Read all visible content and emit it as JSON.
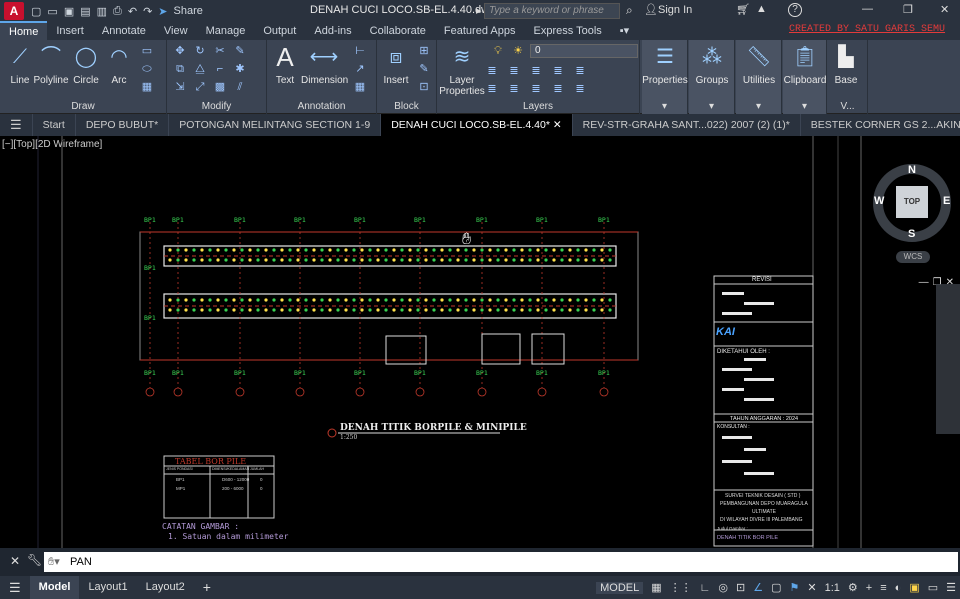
{
  "titlebar": {
    "logo": "A",
    "file_title": "DENAH CUCI LOCO.SB-EL.4.40.dwg",
    "share_label": "Share",
    "search_placeholder": "Type a keyword or phrase",
    "sign_in": "Sign In",
    "help": "?"
  },
  "ribbon_tabs": [
    "Home",
    "Insert",
    "Annotate",
    "View",
    "Manage",
    "Output",
    "Add-ins",
    "Collaborate",
    "Featured Apps",
    "Express Tools"
  ],
  "active_ribbon_tab": "Home",
  "credit_text": "CREATED BY SATU GARIS SEMU",
  "panels": {
    "draw": {
      "label": "Draw",
      "line": "Line",
      "polyline": "Polyline",
      "circle": "Circle",
      "arc": "Arc"
    },
    "modify": {
      "label": "Modify"
    },
    "annotation": {
      "label": "Annotation",
      "text": "Text",
      "dimension": "Dimension"
    },
    "block": {
      "label": "Block",
      "insert": "Insert"
    },
    "layers": {
      "label": "Layers",
      "layer_properties_1": "Layer",
      "layer_properties_2": "Properties",
      "current_layer": "0"
    },
    "properties": "Properties",
    "groups": "Groups",
    "utilities": "Utilities",
    "clipboard": "Clipboard",
    "base": "Base",
    "view": "V..."
  },
  "doc_tabs": [
    "Start",
    "DEPO BUBUT*",
    "POTONGAN MELINTANG SECTION 1-9",
    "DENAH CUCI LOCO.SB-EL.4.40*",
    "REV-STR-GRAHA SANT...022) 2007 (2) (1)*",
    "BESTEK CORNER GS 2...AKIN 2007 (2) (1)*"
  ],
  "active_doc_tab": 3,
  "viewport_label": "[−][Top][2D Wireframe]",
  "drawing": {
    "pile_label": "BP1",
    "title": "DENAH TITIK BORPILE & MINIPILE",
    "scale": "1:250",
    "table_title": "TABEL BOR PILE",
    "table_headers": [
      "JENIS PONDASI",
      "DIMENSI/KEDALAMAN",
      "JUMLAH"
    ],
    "table_rows": [
      [
        "BP1",
        "D600 - 12000",
        "0"
      ],
      [
        "MP1",
        "200 - 6000",
        "0"
      ]
    ],
    "notes_title": "CATATAN GAMBAR :",
    "note_1": "1.  Satuan dalam milimeter",
    "revisi": "REVISI",
    "diketahui": "DIKETAHUI OLEH :",
    "tahun": "TAHUN ANGGARAN : 2024",
    "konsultan": "KONSULTAN :",
    "project_1": "SURVEI TEKNIK DESAIN ( STD )",
    "project_2": "PEMBANGUNAN DEPO MUARAGULA",
    "project_3": "ULTIMATE",
    "project_4": "DI WILAYAH DIVRE III PALEMBANG",
    "judul_label": "Judul Gambar :",
    "judul": "DENAH TITIK BOR PILE",
    "kai_logo": "KAI"
  },
  "viewcube": {
    "n": "N",
    "s": "S",
    "e": "E",
    "w": "W",
    "face": "TOP",
    "wcs": "WCS"
  },
  "command": {
    "prompt": "PAN"
  },
  "status": {
    "model_tab": "Model",
    "layout1": "Layout1",
    "layout2": "Layout2",
    "model_button": "MODEL",
    "scale": "1:1"
  },
  "colors": {
    "pile_green": "#39d353",
    "drawing_red": "#c0392b",
    "drawing_white": "#e8e8e8",
    "accent_blue": "#5ea6e9",
    "credit_red": "#e23b3b"
  }
}
